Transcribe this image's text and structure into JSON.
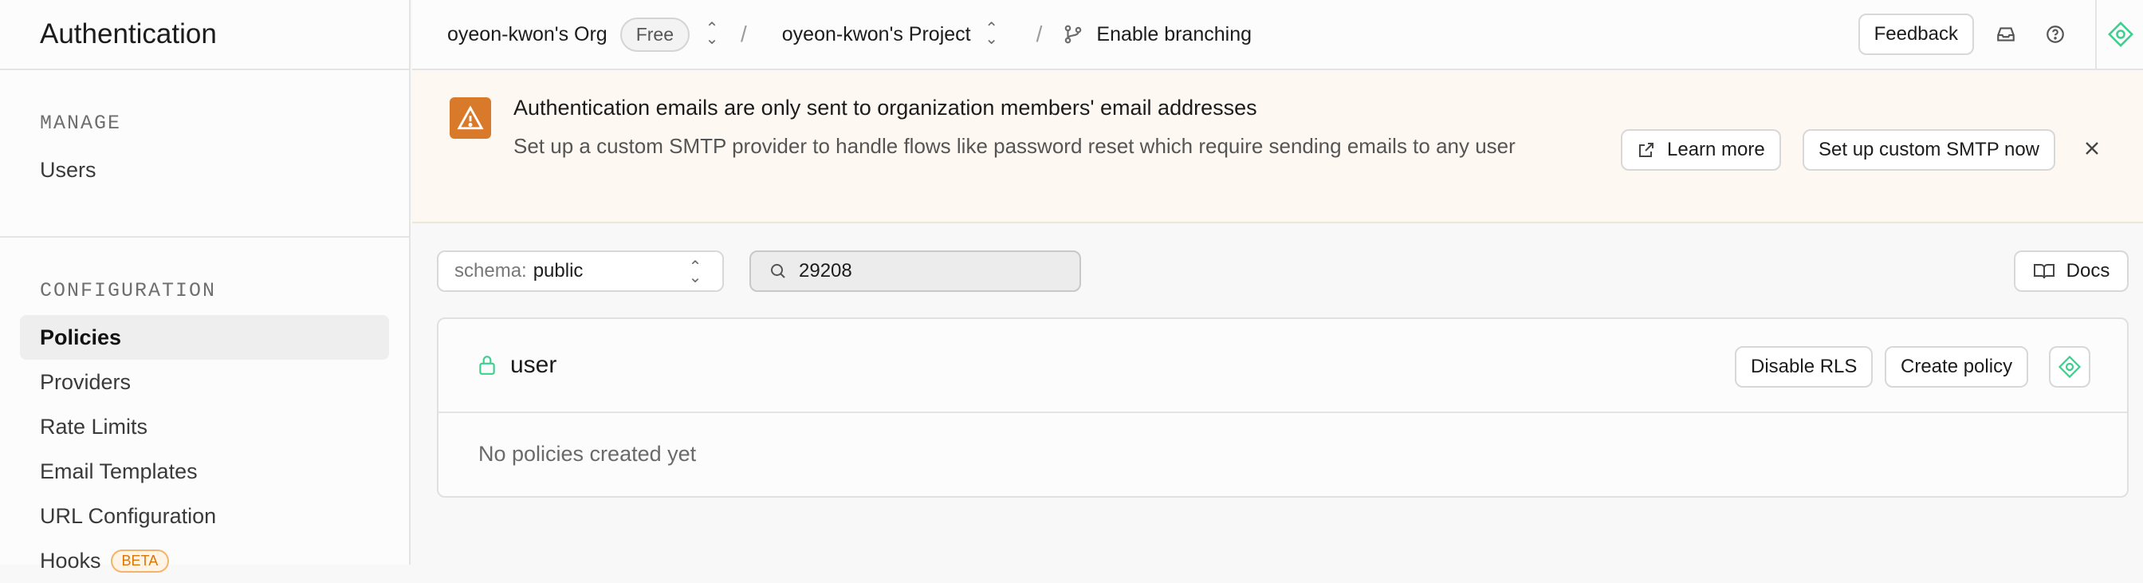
{
  "sidebar": {
    "title": "Authentication",
    "manage_label": "MANAGE",
    "manage_items": [
      {
        "label": "Users"
      }
    ],
    "config_label": "CONFIGURATION",
    "config_items": [
      {
        "label": "Policies",
        "active": true
      },
      {
        "label": "Providers"
      },
      {
        "label": "Rate Limits"
      },
      {
        "label": "Email Templates"
      },
      {
        "label": "URL Configuration"
      },
      {
        "label": "Hooks",
        "badge": "BETA"
      }
    ]
  },
  "topbar": {
    "org": "oyeon-kwon's Org",
    "plan": "Free",
    "project": "oyeon-kwon's Project",
    "branching": "Enable branching",
    "feedback": "Feedback"
  },
  "banner": {
    "title": "Authentication emails are only sent to organization members' email addresses",
    "description": "Set up a custom SMTP provider to handle flows like password reset which require sending emails to any user",
    "learn_more": "Learn more",
    "setup_smtp": "Set up custom SMTP now"
  },
  "filters": {
    "schema_prefix": "schema:",
    "schema_value": "public",
    "search_value": "29208",
    "docs": "Docs"
  },
  "table_card": {
    "name": "user",
    "disable_rls": "Disable RLS",
    "create_policy": "Create policy",
    "empty_message": "No policies created yet"
  },
  "colors": {
    "accent_green": "#3ecf8e",
    "warning_orange": "#d97a2b",
    "banner_bg": "#fdf8f1"
  }
}
